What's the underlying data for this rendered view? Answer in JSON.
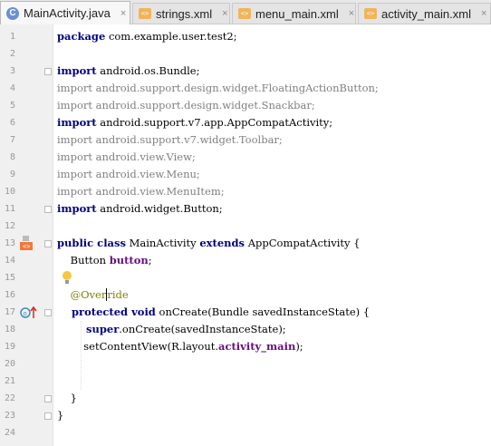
{
  "tabs": [
    {
      "label": "MainActivity.java",
      "icon": "java-class-icon",
      "active": true
    },
    {
      "label": "strings.xml",
      "icon": "xml-file-icon",
      "active": false
    },
    {
      "label": "menu_main.xml",
      "icon": "xml-file-icon",
      "active": false
    },
    {
      "label": "activity_main.xml",
      "icon": "xml-file-icon",
      "active": false
    }
  ],
  "tab_close": "×",
  "lines": [
    {
      "n": "1",
      "segs": [
        [
          "kw",
          "package"
        ],
        [
          "",
          "com.example.user.test2;"
        ]
      ]
    },
    {
      "n": "2",
      "segs": []
    },
    {
      "n": "3",
      "segs": [
        [
          "kw",
          "import"
        ],
        [
          "",
          "android.os.Bundle;"
        ]
      ]
    },
    {
      "n": "4",
      "segs": [
        [
          "imp",
          "import android.support.design.widget.FloatingActionButton;"
        ]
      ]
    },
    {
      "n": "5",
      "segs": [
        [
          "imp",
          "import android.support.design.widget.Snackbar;"
        ]
      ]
    },
    {
      "n": "6",
      "segs": [
        [
          "kw",
          "import"
        ],
        [
          "",
          "android.support.v7.app.AppCompatActivity;"
        ]
      ]
    },
    {
      "n": "7",
      "segs": [
        [
          "imp",
          "import android.support.v7.widget.Toolbar;"
        ]
      ]
    },
    {
      "n": "8",
      "segs": [
        [
          "imp",
          "import android.view.View;"
        ]
      ]
    },
    {
      "n": "9",
      "segs": [
        [
          "imp",
          "import android.view.Menu;"
        ]
      ]
    },
    {
      "n": "10",
      "segs": [
        [
          "imp",
          "import android.view.MenuItem;"
        ]
      ]
    },
    {
      "n": "11",
      "segs": [
        [
          "kw",
          "import"
        ],
        [
          "",
          "android.widget.Button;"
        ]
      ]
    },
    {
      "n": "12",
      "segs": []
    },
    {
      "n": "13",
      "segs": [
        [
          "kw",
          "public class"
        ],
        [
          "",
          "MainActivity"
        ],
        [
          "kw",
          "extends"
        ],
        [
          "",
          "AppCompatActivity {"
        ]
      ]
    },
    {
      "n": "14",
      "segs": [
        [
          "",
          "    Button "
        ],
        [
          "fld",
          "button"
        ],
        [
          "",
          ";"
        ]
      ]
    },
    {
      "n": "15",
      "segs": []
    },
    {
      "n": "16",
      "segs": [
        [
          "ann",
          "    @Over"
        ],
        [
          "caret",
          ""
        ],
        [
          "ann",
          "ride"
        ]
      ]
    },
    {
      "n": "17",
      "segs": [
        [
          "kw",
          "    protected void"
        ],
        [
          "",
          "onCreate(Bundle savedInstanceState) {"
        ]
      ]
    },
    {
      "n": "18",
      "segs": [
        [
          "kw",
          "        super"
        ],
        [
          "",
          ".onCreate(savedInstanceState);"
        ]
      ]
    },
    {
      "n": "19",
      "segs": [
        [
          "",
          "        setContentView(R.layout."
        ],
        [
          "fld",
          "activity_main"
        ],
        [
          "",
          ");"
        ]
      ]
    },
    {
      "n": "20",
      "segs": []
    },
    {
      "n": "21",
      "segs": []
    },
    {
      "n": "22",
      "segs": [
        [
          "",
          "    }"
        ]
      ]
    },
    {
      "n": "23",
      "segs": [
        [
          "",
          "}"
        ]
      ]
    },
    {
      "n": "24",
      "segs": []
    }
  ],
  "gutter_icons": {
    "line13": "run-class-icon",
    "line15": "lightbulb-icon",
    "line17": "override-method-icon"
  },
  "colors": {
    "keyword": "#000080",
    "import_unused": "#808080",
    "annotation": "#808000",
    "field": "#660e7a",
    "current_line": "#fcfce3"
  }
}
